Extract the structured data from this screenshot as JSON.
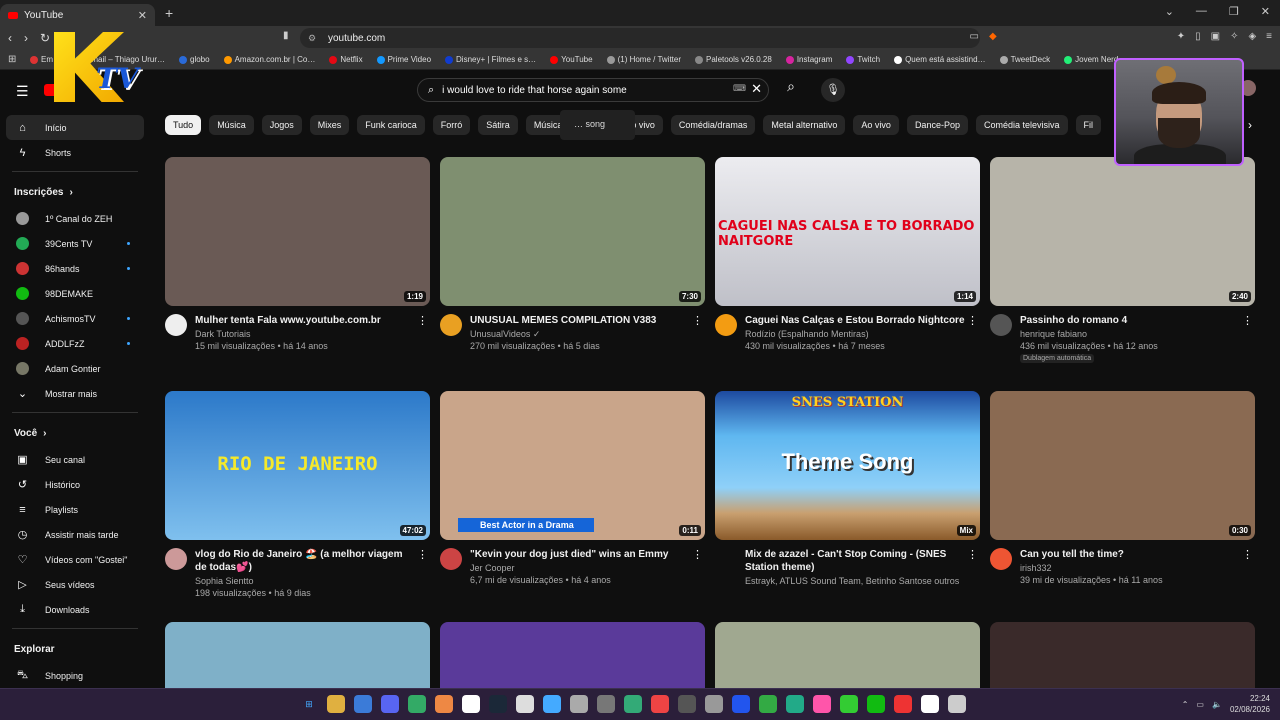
{
  "browser": {
    "tab_title": "YouTube",
    "url": "youtube.com",
    "bookmarks": [
      {
        "label": "Em…",
        "color": "#d33"
      },
      {
        "label": "Email – Thiago Urur…",
        "color": "#1a73e8"
      },
      {
        "label": "globo",
        "color": "#2a6ad8"
      },
      {
        "label": "Amazon.com.br | Co…",
        "color": "#ff9900"
      },
      {
        "label": "Netflix",
        "color": "#e50914"
      },
      {
        "label": "Prime Video",
        "color": "#1399ff"
      },
      {
        "label": "Disney+ | Filmes e s…",
        "color": "#113ccf"
      },
      {
        "label": "YouTube",
        "color": "#ff0000"
      },
      {
        "label": "(1) Home / Twitter",
        "color": "#999"
      },
      {
        "label": "Paletools v26.0.28",
        "color": "#888"
      },
      {
        "label": "Instagram",
        "color": "#d6249f"
      },
      {
        "label": "Twitch",
        "color": "#9146ff"
      },
      {
        "label": "Quem está assistind…",
        "color": "#fff"
      },
      {
        "label": "TweetDeck",
        "color": "#aaa"
      },
      {
        "label": "Jovem Nerd – …",
        "color": "#2e7"
      }
    ]
  },
  "youtube": {
    "search_query": "i would love to ride that horse again some",
    "suggestion": "… song",
    "sidebar": {
      "home": "Início",
      "shorts": "Shorts",
      "subscriptions_header": "Inscrições",
      "subscriptions": [
        {
          "label": "1º Canal do ZEH",
          "color": "#999",
          "dot": false
        },
        {
          "label": "39Cents TV",
          "color": "#2a5",
          "dot": true
        },
        {
          "label": "86hands",
          "color": "#c33",
          "dot": true
        },
        {
          "label": "98DEMAKE",
          "color": "#1b1",
          "dot": false
        },
        {
          "label": "AchismosTV",
          "color": "#555",
          "dot": true
        },
        {
          "label": "ADDLFzZ",
          "color": "#b22",
          "dot": true
        },
        {
          "label": "Adam Gontier",
          "color": "#776",
          "dot": false
        }
      ],
      "show_more": "Mostrar mais",
      "you_header": "Você",
      "you_items": [
        {
          "label": "Seu canal",
          "icon": "channel-icon",
          "glyph": "▣"
        },
        {
          "label": "Histórico",
          "icon": "history-icon",
          "glyph": "↺"
        },
        {
          "label": "Playlists",
          "icon": "playlists-icon",
          "glyph": "≡"
        },
        {
          "label": "Assistir mais tarde",
          "icon": "watch-later-icon",
          "glyph": "◷"
        },
        {
          "label": "Vídeos com \"Gostei\"",
          "icon": "like-icon",
          "glyph": "♡"
        },
        {
          "label": "Seus vídeos",
          "icon": "your-videos-icon",
          "glyph": "▷"
        },
        {
          "label": "Downloads",
          "icon": "download-icon",
          "glyph": "⤓"
        }
      ],
      "explore_header": "Explorar",
      "shopping": "Shopping"
    },
    "chips": [
      "Tudo",
      "Música",
      "Jogos",
      "Mixes",
      "Funk carioca",
      "Forró",
      "Sátira",
      "Música br",
      "s",
      "Ao vivo",
      "Comédia/dramas",
      "Metal alternativo",
      "Ao vivo",
      "Dance-Pop",
      "Comédia televisiva",
      "Fil"
    ],
    "videos": [
      {
        "title": "Mulher tenta Fala www.youtube.com.br",
        "channel": "Dark Tutoriais",
        "stats": "15 mil visualizações • há 14 anos",
        "duration": "1:19",
        "thumb": "#6a5a55",
        "avatar": "#eee",
        "overlay": ""
      },
      {
        "title": "UNUSUAL MEMES COMPILATION V383",
        "channel": "UnusualVideos ✓",
        "stats": "270 mil visualizações • há 5 dias",
        "duration": "7:30",
        "thumb": "#7f8f70",
        "avatar": "#e9a022",
        "overlay": ""
      },
      {
        "title": "Caguei Nas Calças e Estou Borrado Nightcore",
        "channel": "Rodízio (Espalhando Mentiras)",
        "stats": "430 mil visualizações • há 7 meses",
        "duration": "1:14",
        "thumb": "#d9d9de",
        "avatar": "#f39c12",
        "overlay": "CAGUEI NAS CALSA E TO BORRADO NAITGORE"
      },
      {
        "title": "Passinho do romano 4",
        "channel": "henrique fabiano",
        "stats": "436 mil visualizações • há 12 anos",
        "duration": "2:40",
        "thumb": "#b7b4a9",
        "avatar": "#555",
        "overlay": ""
      },
      {
        "title": "vlog do Rio de Janeiro 🏖️ (a melhor viagem de todas💕)",
        "channel": "Sophia Sientto",
        "stats": "198 visualizações • há 9 dias",
        "duration": "47:02",
        "thumb": "#3a8ad6",
        "avatar": "#c99",
        "overlay": "RIO DE JANEIRO"
      },
      {
        "title": "\"Kevin your dog just died\" wins an Emmy",
        "channel": "Jer Cooper",
        "stats": "6,7 mi de visualizações • há 4 anos",
        "duration": "0:11",
        "thumb": "#c9a58a",
        "avatar": "#c44",
        "overlay": "Best Actor in a Drama"
      },
      {
        "title": "Mix de azazel - Can't Stop Coming - (SNES Station theme)",
        "channel": "Estrayk, ATLUS Sound Team, Betinho Santose outros",
        "stats": "",
        "duration": "Mix",
        "thumb": "#4aa0e0",
        "avatar": "",
        "overlay": "Theme Song"
      },
      {
        "title": "Can you tell the time?",
        "channel": "irish332",
        "stats": "39 mi de visualizações • há 11 anos",
        "duration": "0:30",
        "thumb": "#8a6a52",
        "avatar": "#e53",
        "overlay": ""
      }
    ],
    "dubbing_badge": "Dublagem automática",
    "snes_banner": "SNES STATION"
  },
  "taskbar": {
    "time": "22:24",
    "date": "02/08/2026",
    "icons": [
      "#3a8ee6",
      "#e0b040",
      "#3b7bd8",
      "#5865f2",
      "#3a6",
      "#e84",
      "#fff",
      "#1b2838",
      "#ddd",
      "#4af",
      "#aaa",
      "#777",
      "#3a7",
      "#e44",
      "#555",
      "#999",
      "#25e",
      "#3a4",
      "#2a8",
      "#f5a",
      "#3c3",
      "#1b1",
      "#e33",
      "#fff",
      "#ccc"
    ]
  }
}
